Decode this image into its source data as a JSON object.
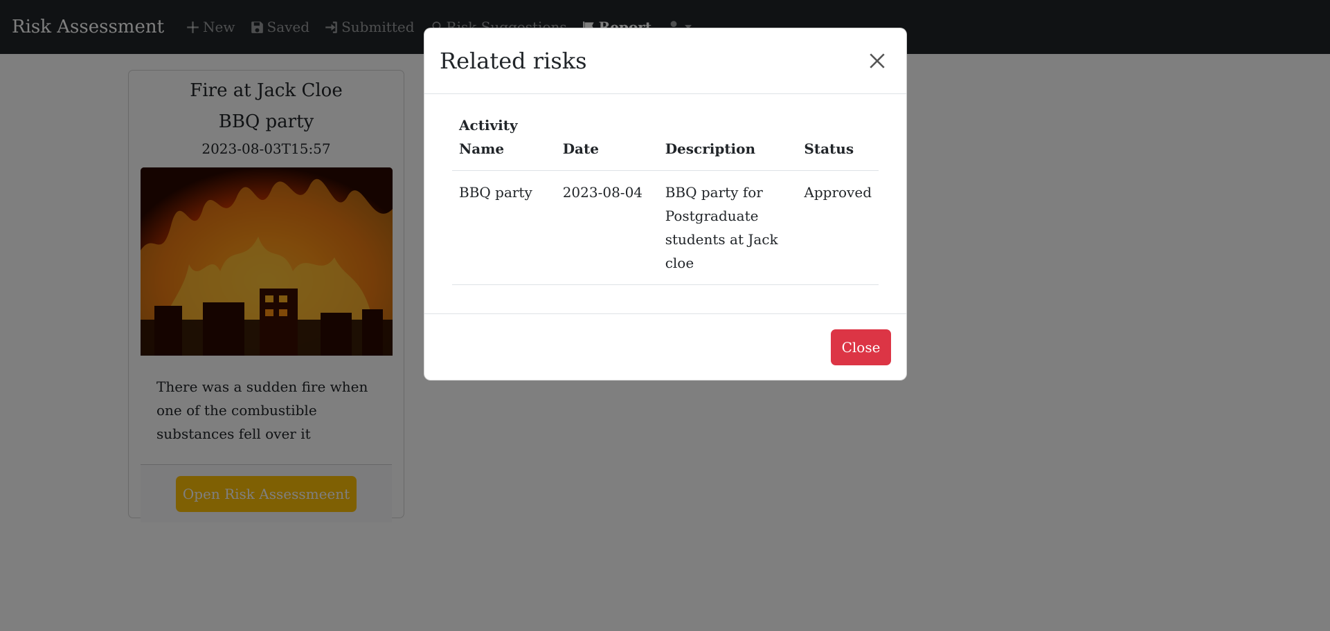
{
  "navbar": {
    "brand": "Risk Assessment",
    "items": [
      {
        "label": "New",
        "icon": "plus-icon"
      },
      {
        "label": "Saved",
        "icon": "floppy-disk-icon"
      },
      {
        "label": "Submitted",
        "icon": "sign-in-icon"
      },
      {
        "label": "Risk Suggestions",
        "icon": "lightbulb-icon"
      },
      {
        "label": "Report",
        "icon": "flag-icon"
      }
    ],
    "user_icon": "user-icon"
  },
  "card": {
    "title": "Fire at Jack Cloe",
    "activity": "BBQ party",
    "datetime": "2023-08-03T15:57",
    "image": "burning-building-photo",
    "description": "There was a sudden fire when one of the combustible substances fell over it",
    "button_label": "Open Risk Assessmeent"
  },
  "modal": {
    "title": "Related risks",
    "columns": [
      "Activity Name",
      "Date",
      "Description",
      "Status"
    ],
    "rows": [
      {
        "activity_name": "BBQ party",
        "date": "2023-08-04",
        "description": "BBQ party for Postgraduate students at Jack cloe",
        "status": "Approved"
      }
    ],
    "close_label": "Close"
  },
  "colors": {
    "navbar": "#212529",
    "warning": "#ffc107",
    "danger": "#dc3545"
  }
}
